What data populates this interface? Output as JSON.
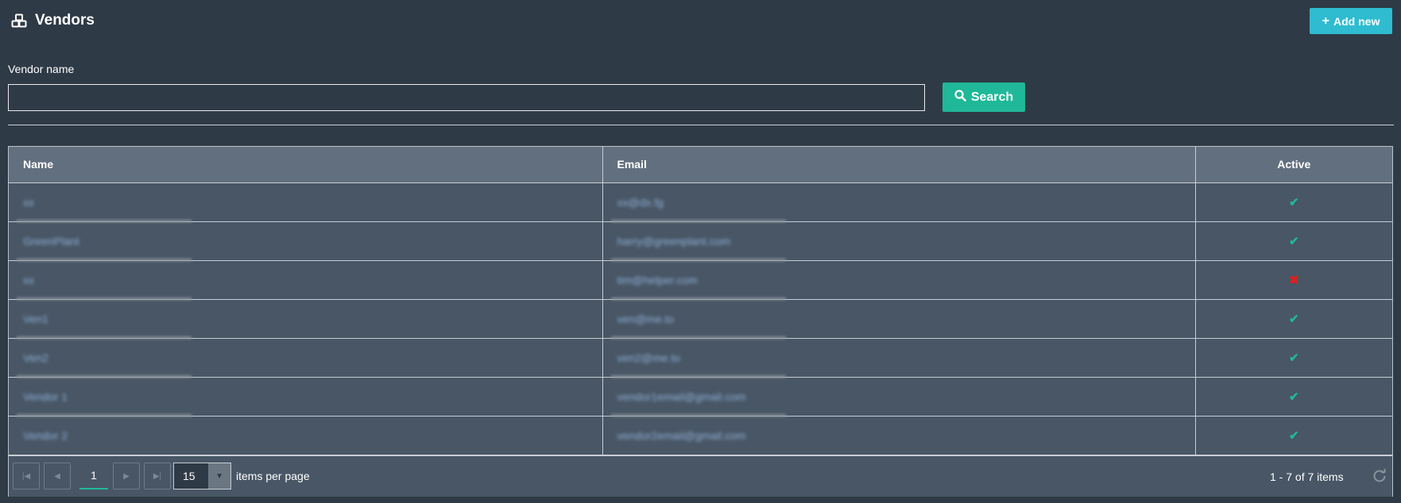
{
  "header": {
    "title": "Vendors",
    "logo_icon": "cubes-icon",
    "add_button_label": "Add new"
  },
  "search": {
    "label": "Vendor name",
    "value": "",
    "placeholder": "",
    "button_label": "Search"
  },
  "grid": {
    "columns": [
      "Name",
      "Email",
      "Active"
    ],
    "rows": [
      {
        "name": "xx",
        "email": "xx@dx.fg",
        "active": "✔"
      },
      {
        "name": "GreenPlant",
        "email": "harry@greenplant.com",
        "active": "✔"
      },
      {
        "name": "xx",
        "email": "tim@helper.com",
        "active": "✖"
      },
      {
        "name": "Ven1",
        "email": "ven@me.to",
        "active": "✔"
      },
      {
        "name": "Ven2",
        "email": "ven2@me.to",
        "active": "✔"
      },
      {
        "name": "Vendor 1",
        "email": "vendor1email@gmail.com",
        "active": "✔"
      },
      {
        "name": "Vendor 2",
        "email": "vendor2email@gmail.com",
        "active": "✔"
      }
    ]
  },
  "pager": {
    "current_page": "1",
    "page_size": "15",
    "items_per_page_label": "items per page",
    "info": "1 - 7 of 7 items"
  },
  "colors": {
    "background": "#2f3a47",
    "accent_add": "#2fbcd0",
    "accent_search": "#1fb898",
    "active_check": "#1fb898",
    "inactive_cross": "#e0201c"
  }
}
